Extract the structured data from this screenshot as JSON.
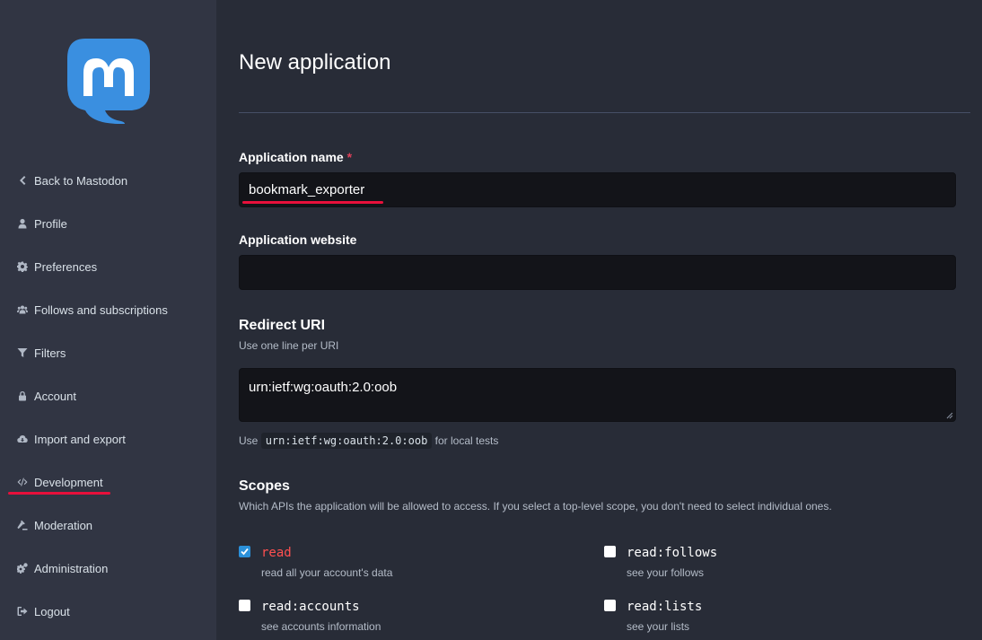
{
  "sidebar": {
    "items": [
      {
        "label": "Back to Mastodon",
        "icon": "chevron-left-icon"
      },
      {
        "label": "Profile",
        "icon": "user-icon"
      },
      {
        "label": "Preferences",
        "icon": "gear-icon"
      },
      {
        "label": "Follows and subscriptions",
        "icon": "users-icon"
      },
      {
        "label": "Filters",
        "icon": "filter-icon"
      },
      {
        "label": "Account",
        "icon": "lock-icon"
      },
      {
        "label": "Import and export",
        "icon": "cloud-download-icon"
      },
      {
        "label": "Development",
        "icon": "code-icon"
      },
      {
        "label": "Moderation",
        "icon": "gavel-icon"
      },
      {
        "label": "Administration",
        "icon": "cogs-icon"
      },
      {
        "label": "Logout",
        "icon": "sign-out-icon"
      }
    ]
  },
  "page": {
    "title": "New application"
  },
  "form": {
    "app_name": {
      "label": "Application name",
      "required_mark": "*",
      "value": "bookmark_exporter"
    },
    "app_website": {
      "label": "Application website",
      "value": ""
    },
    "redirect": {
      "title": "Redirect URI",
      "hint": "Use one line per URI",
      "value": "urn:ietf:wg:oauth:2.0:oob",
      "footer_prefix": "Use",
      "footer_code": "urn:ietf:wg:oauth:2.0:oob",
      "footer_suffix": "for local tests"
    },
    "scopes": {
      "title": "Scopes",
      "hint": "Which APIs the application will be allowed to access. If you select a top-level scope, you don't need to select individual ones.",
      "items": [
        {
          "name": "read",
          "desc": "read all your account's data",
          "checked": true
        },
        {
          "name": "read:follows",
          "desc": "see your follows",
          "checked": false
        },
        {
          "name": "read:accounts",
          "desc": "see accounts information",
          "checked": false
        },
        {
          "name": "read:lists",
          "desc": "see your lists",
          "checked": false
        }
      ]
    }
  },
  "colors": {
    "accent": "#2b90d9",
    "annotation": "#e8103b",
    "danger": "#ff5050"
  }
}
